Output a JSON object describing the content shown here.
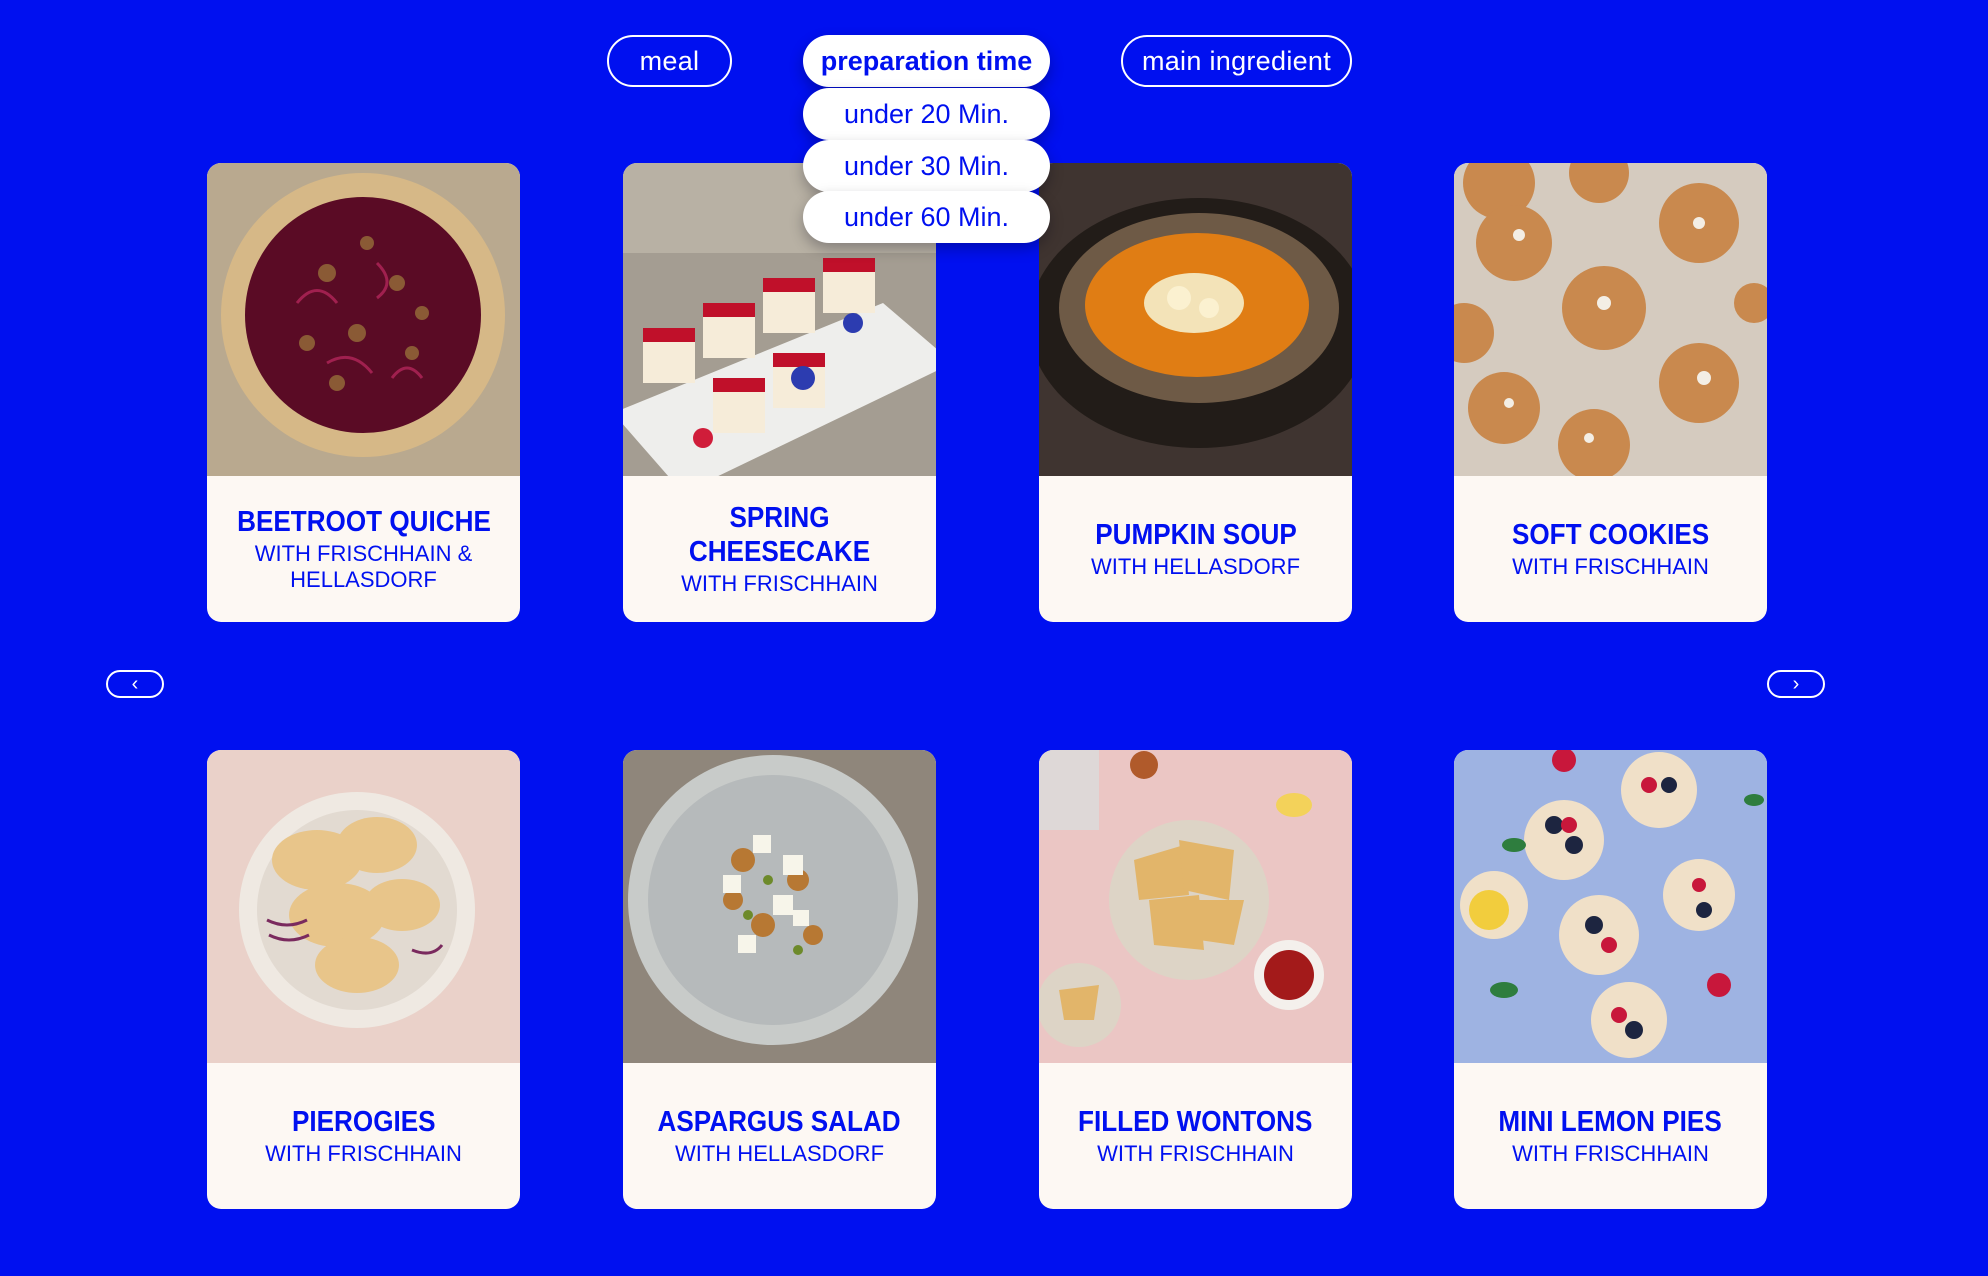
{
  "filters": {
    "meal": "meal",
    "preparation_time": "preparation time",
    "main_ingredient": "main ingredient",
    "time_options": [
      "under 20 Min.",
      "under 30 Min.",
      "under 60 Min."
    ]
  },
  "nav": {
    "prev": "‹",
    "next": "›"
  },
  "recipes": [
    {
      "title": "BEETROOT QUICHE",
      "subtitle": "WITH FRISCHHAIN & HELLASDORF"
    },
    {
      "title": "SPRING  CHEESECAKE",
      "subtitle": "WITH FRISCHHAIN"
    },
    {
      "title": "PUMPKIN SOUP",
      "subtitle": "WITH HELLASDORF"
    },
    {
      "title": "SOFT COOKIES",
      "subtitle": "WITH FRISCHHAIN"
    },
    {
      "title": "PIEROGIES",
      "subtitle": "WITH FRISCHHAIN"
    },
    {
      "title": "ASPARGUS SALAD",
      "subtitle": "WITH HELLASDORF"
    },
    {
      "title": "FILLED WONTONS",
      "subtitle": "WITH FRISCHHAIN"
    },
    {
      "title": "MINI LEMON PIES",
      "subtitle": "WITH FRISCHHAIN"
    }
  ],
  "colors": {
    "background": "#0010f0",
    "card": "#fdf8f3",
    "accent": "#ffffff"
  }
}
